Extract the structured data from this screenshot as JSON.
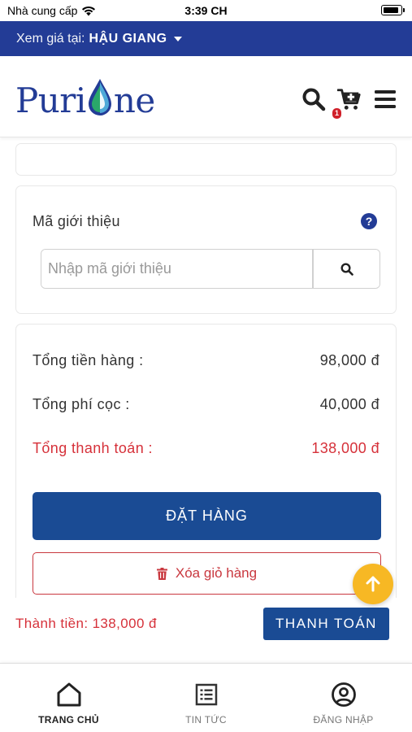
{
  "status_bar": {
    "carrier": "Nhà cung cấp",
    "time": "3:39 CH"
  },
  "location_bar": {
    "prefix": "Xem giá tại:",
    "city": "HẬU GIANG"
  },
  "header": {
    "logo_left": "Puri",
    "logo_right": "ne",
    "cart_count": "1",
    "icons": [
      "search-icon",
      "cart-plus-icon",
      "menu-icon"
    ]
  },
  "referral": {
    "title": "Mã giới thiệu",
    "input_placeholder": "Nhập mã giới thiệu",
    "input_value": ""
  },
  "totals": {
    "goods_label": "Tổng tiền hàng :",
    "goods_value": "98,000 đ",
    "deposit_label": "Tổng phí cọc :",
    "deposit_value": "40,000 đ",
    "grand_label": "Tổng thanh toán :",
    "grand_value": "138,000 đ"
  },
  "actions": {
    "order_label": "ĐẶT HÀNG",
    "clear_label": "Xóa giỏ hàng"
  },
  "checkout": {
    "subtotal": "Thành tiền: 138,000 đ",
    "pay_label": "THANH TOÁN"
  },
  "tabs": [
    {
      "label": "TRANG CHỦ",
      "icon": "home-icon",
      "active": true
    },
    {
      "label": "TIN TỨC",
      "icon": "news-icon",
      "active": false
    },
    {
      "label": "ĐĂNG NHẬP",
      "icon": "account-icon",
      "active": false
    }
  ],
  "colors": {
    "brand_blue": "#233c96",
    "button_blue": "#1a4b94",
    "accent_red": "#d6313a",
    "scroll_top_yellow": "#f7b824"
  }
}
